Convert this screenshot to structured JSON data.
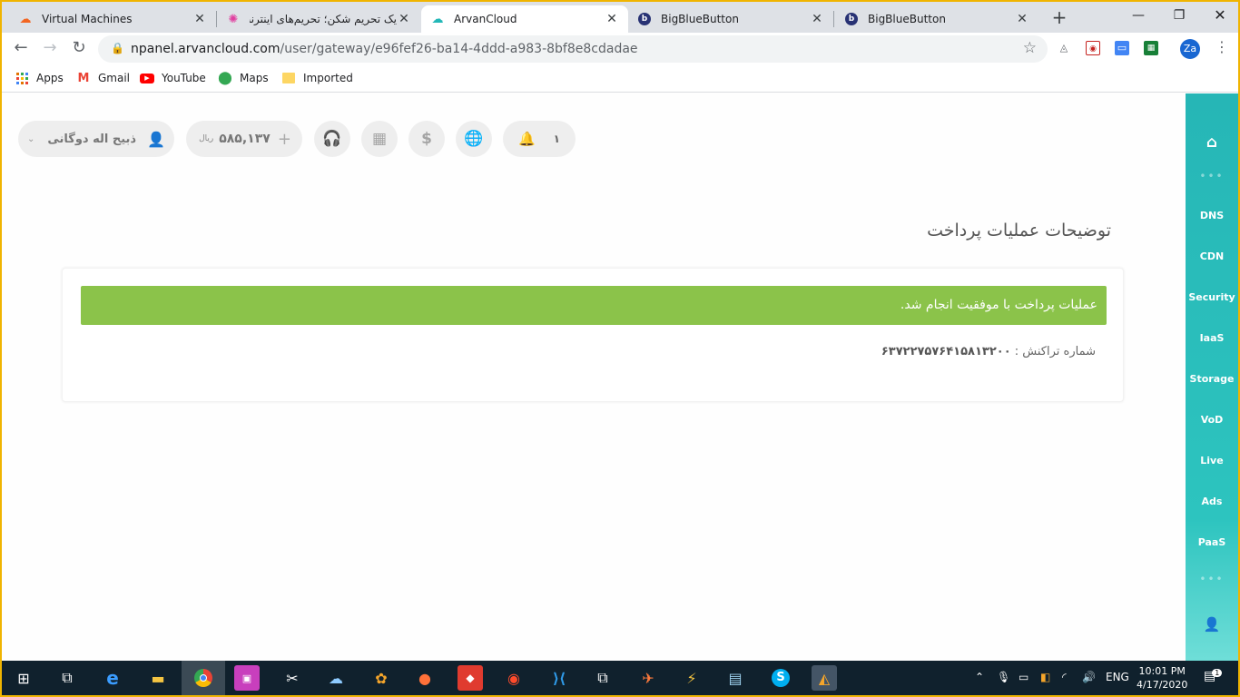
{
  "browser": {
    "tabs": [
      {
        "title": "Virtual Machines"
      },
      {
        "title": "یک تحریم شکن؛ تحریم‌های اینترنت..."
      },
      {
        "title": "ArvanCloud"
      },
      {
        "title": "BigBlueButton"
      },
      {
        "title": "BigBlueButton"
      }
    ],
    "url_host": "npanel.arvancloud.com",
    "url_path": "/user/gateway/e96fef26-ba14-4ddd-a983-8bf8e8cdadae",
    "profile_initials": "Za",
    "bookmarks": [
      "Apps",
      "Gmail",
      "YouTube",
      "Maps",
      "Imported"
    ]
  },
  "header": {
    "user_name": "ذبیح اله دوگانی",
    "balance": "۵۸۵,۱۳۷",
    "balance_unit": "ریال",
    "notification_count": "۱"
  },
  "main": {
    "section_title": "توضیحات عملیات پرداخت",
    "success_message": "عملیات پرداخت با موفقیت انجام شد.",
    "transaction_label": "شماره تراکنش :",
    "transaction_number": "۶۳۷۲۲۷۵۷۶۴۱۵۸۱۳۲۰۰"
  },
  "sidebar": {
    "items": [
      "DNS",
      "CDN",
      "Security",
      "IaaS",
      "Storage",
      "VoD",
      "Live",
      "Ads",
      "PaaS"
    ]
  },
  "taskbar": {
    "language": "ENG",
    "time": "10:01 PM",
    "date": "4/17/2020",
    "notifications_badge": "1"
  },
  "colors": {
    "success": "#8bc34a",
    "sidebar": "#2dc4bf",
    "taskbar": "#10212d"
  }
}
